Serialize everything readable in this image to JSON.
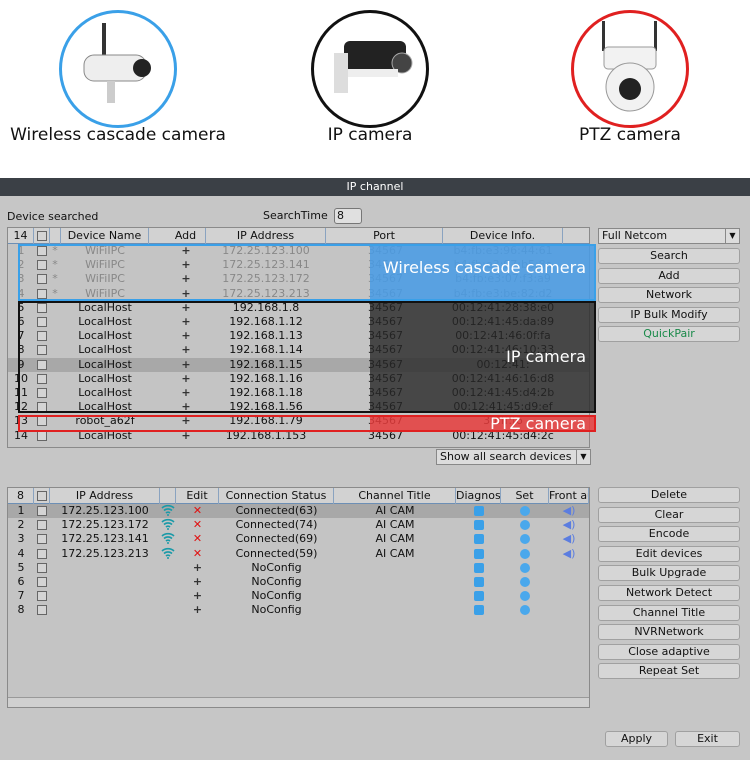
{
  "promo": {
    "items": [
      {
        "label": "Wireless cascade camera",
        "color": "#3aa0e8"
      },
      {
        "label": "IP camera",
        "color": "#111111"
      },
      {
        "label": "PTZ camera",
        "color": "#e02020"
      }
    ]
  },
  "dialog": {
    "title": "IP channel",
    "device_searched": "Device searched",
    "search_time_label": "SearchTime",
    "search_time_value": "8",
    "search_table": {
      "count": "14",
      "headers": [
        "Device Name",
        "Add",
        "IP Address",
        "Port",
        "Device Info."
      ],
      "rows": [
        [
          "1",
          "*",
          "WiFiIPC",
          "172.25.123.100",
          "34567",
          "b4:fb:e3:96:44:61"
        ],
        [
          "2",
          "*",
          "WiFiIPC",
          "172.25.123.141",
          "34567",
          "b4:fb:e3:07:b5:8a"
        ],
        [
          "3",
          "*",
          "WiFiIPC",
          "172.25.123.172",
          "34567",
          "b4:fb:e3:07:f3:a9"
        ],
        [
          "4",
          "*",
          "WiFiIPC",
          "172.25.123.213",
          "34567",
          "b4:fb:e3:be:82:d2"
        ],
        [
          "5",
          "",
          "LocalHost",
          "192.168.1.8",
          "34567",
          "00:12:41:28:38:e0"
        ],
        [
          "6",
          "",
          "LocalHost",
          "192.168.1.12",
          "34567",
          "00:12:41:45:da:89"
        ],
        [
          "7",
          "",
          "LocalHost",
          "192.168.1.13",
          "34567",
          "00:12:41:46:0f:fa"
        ],
        [
          "8",
          "",
          "LocalHost",
          "192.168.1.14",
          "34567",
          "00:12:41:46:10:33"
        ],
        [
          "9",
          "",
          "LocalHost",
          "192.168.1.15",
          "34567",
          "00:12:41:"
        ],
        [
          "10",
          "",
          "LocalHost",
          "192.168.1.16",
          "34567",
          "00:12:41:46:16:d8"
        ],
        [
          "11",
          "",
          "LocalHost",
          "192.168.1.18",
          "34567",
          "00:12:41:45:d4:2b"
        ],
        [
          "12",
          "",
          "LocalHost",
          "192.168.1.56",
          "34567",
          "00:12:41:45:d9:ef"
        ],
        [
          "13",
          "",
          "robot_a62f",
          "192.168.1.79",
          "34567",
          "30:ff:f6"
        ],
        [
          "14",
          "",
          "LocalHost",
          "192.168.1.153",
          "34567",
          "00:12:41:45:d4:2c"
        ]
      ],
      "overlays": {
        "wireless": "Wireless cascade camera",
        "ip": "IP camera",
        "ptz": "PTZ camera"
      }
    },
    "protocol_select": "Full Netcom",
    "top_buttons": [
      "Search",
      "Add",
      "Network",
      "IP Bulk Modify",
      "QuickPair"
    ],
    "quickpair_color": "#1a8a4a",
    "filter_select": "Show all search devices",
    "channel_table": {
      "count": "8",
      "headers": [
        "IP Address",
        "Edit",
        "Connection Status",
        "Channel Title",
        "Diagnosis",
        "Set",
        "Front audio"
      ],
      "rows": [
        [
          "1",
          "172.25.123.100",
          "wifi",
          "x",
          "Connected(63)",
          "AI CAM",
          "audio"
        ],
        [
          "2",
          "172.25.123.172",
          "wifi",
          "x",
          "Connected(74)",
          "AI CAM",
          "audio"
        ],
        [
          "3",
          "172.25.123.141",
          "wifi",
          "x",
          "Connected(69)",
          "AI CAM",
          "audio"
        ],
        [
          "4",
          "172.25.123.213",
          "wifi",
          "x",
          "Connected(59)",
          "AI CAM",
          "audio"
        ],
        [
          "5",
          "",
          "",
          "+",
          "NoConfig",
          "",
          ""
        ],
        [
          "6",
          "",
          "",
          "+",
          "NoConfig",
          "",
          ""
        ],
        [
          "7",
          "",
          "",
          "+",
          "NoConfig",
          "",
          ""
        ],
        [
          "8",
          "",
          "",
          "+",
          "NoConfig",
          "",
          ""
        ]
      ]
    },
    "side_buttons": [
      "Delete",
      "Clear",
      "Encode",
      "Edit devices",
      "Bulk Upgrade",
      "Network Detect",
      "Channel Title",
      "NVRNetwork",
      "Close adaptive",
      "Repeat Set"
    ],
    "apply": "Apply",
    "exit": "Exit"
  }
}
